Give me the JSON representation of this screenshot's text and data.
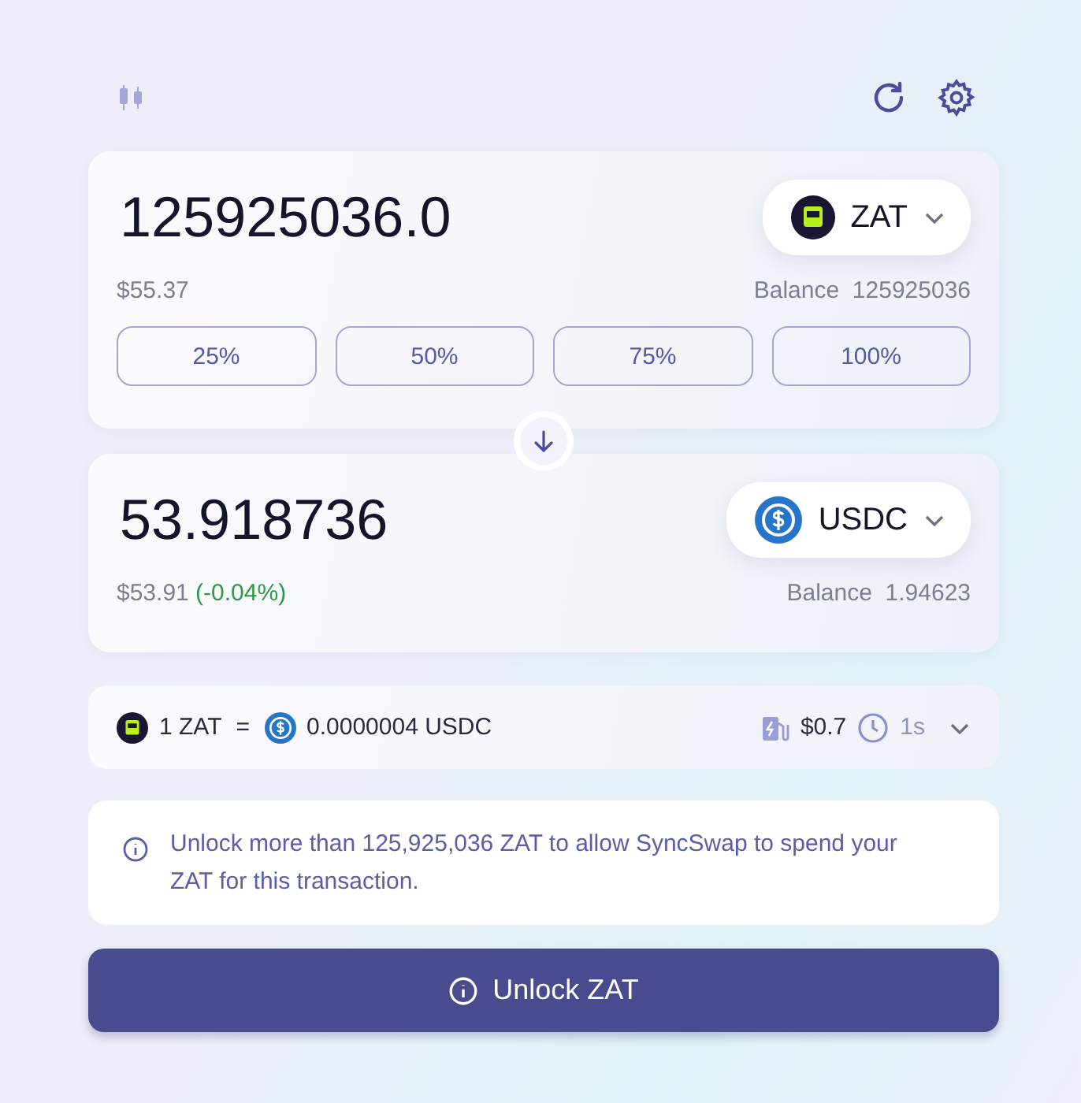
{
  "from": {
    "amount": "125925036.0",
    "token": {
      "symbol": "ZAT",
      "kind": "zat"
    },
    "usd": "$55.37",
    "balance_label": "Balance",
    "balance": "125925036"
  },
  "percent_buttons": [
    "25%",
    "50%",
    "75%",
    "100%"
  ],
  "to": {
    "amount": "53.918736",
    "token": {
      "symbol": "USDC",
      "kind": "usdc"
    },
    "usd": "$53.91",
    "change": "(-0.04%)",
    "balance_label": "Balance",
    "balance": "1.94623"
  },
  "rate": {
    "left": {
      "text": "1 ZAT",
      "kind": "zat"
    },
    "equals": "=",
    "right": {
      "text": "0.0000004 USDC",
      "kind": "usdc"
    },
    "gas": "$0.7",
    "time": "1s"
  },
  "notice": "Unlock more than 125,925,036 ZAT to allow SyncSwap to spend your ZAT for this transaction.",
  "action_button": "Unlock ZAT"
}
